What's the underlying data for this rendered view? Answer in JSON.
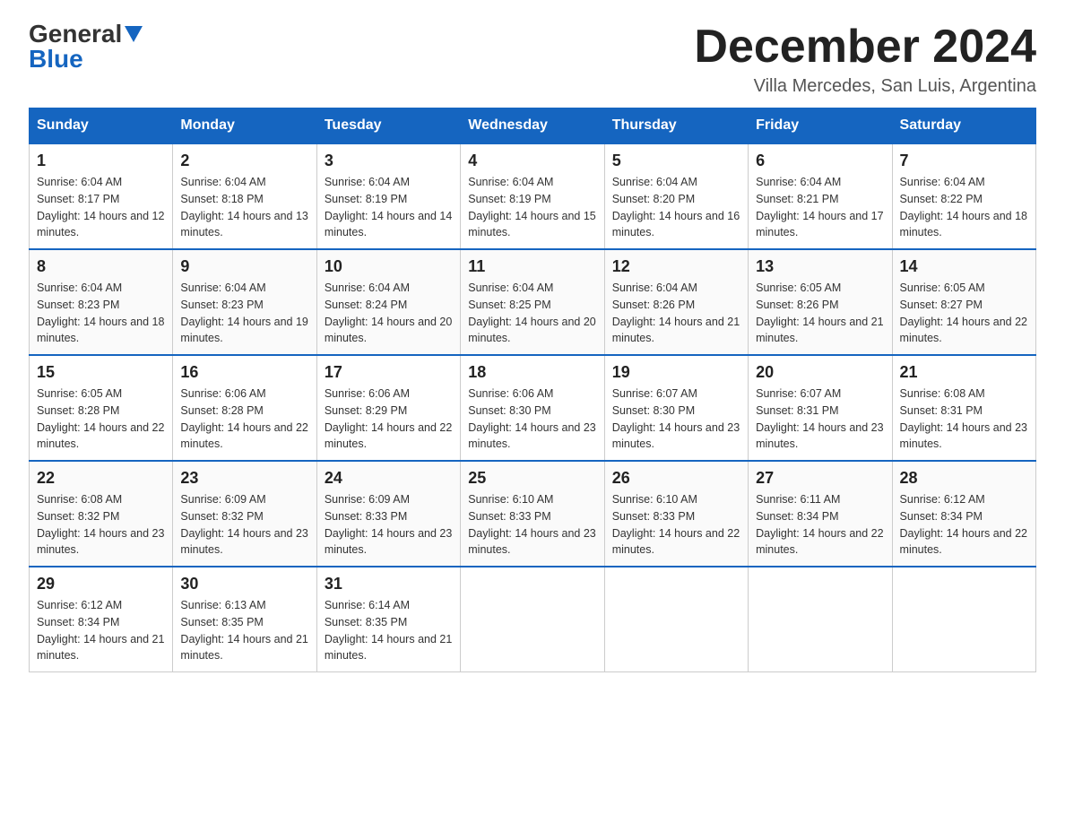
{
  "logo": {
    "general": "General",
    "blue": "Blue"
  },
  "header": {
    "month_title": "December 2024",
    "subtitle": "Villa Mercedes, San Luis, Argentina"
  },
  "days_of_week": [
    "Sunday",
    "Monday",
    "Tuesday",
    "Wednesday",
    "Thursday",
    "Friday",
    "Saturday"
  ],
  "weeks": [
    [
      {
        "day": "1",
        "sunrise": "6:04 AM",
        "sunset": "8:17 PM",
        "daylight": "14 hours and 12 minutes."
      },
      {
        "day": "2",
        "sunrise": "6:04 AM",
        "sunset": "8:18 PM",
        "daylight": "14 hours and 13 minutes."
      },
      {
        "day": "3",
        "sunrise": "6:04 AM",
        "sunset": "8:19 PM",
        "daylight": "14 hours and 14 minutes."
      },
      {
        "day": "4",
        "sunrise": "6:04 AM",
        "sunset": "8:19 PM",
        "daylight": "14 hours and 15 minutes."
      },
      {
        "day": "5",
        "sunrise": "6:04 AM",
        "sunset": "8:20 PM",
        "daylight": "14 hours and 16 minutes."
      },
      {
        "day": "6",
        "sunrise": "6:04 AM",
        "sunset": "8:21 PM",
        "daylight": "14 hours and 17 minutes."
      },
      {
        "day": "7",
        "sunrise": "6:04 AM",
        "sunset": "8:22 PM",
        "daylight": "14 hours and 18 minutes."
      }
    ],
    [
      {
        "day": "8",
        "sunrise": "6:04 AM",
        "sunset": "8:23 PM",
        "daylight": "14 hours and 18 minutes."
      },
      {
        "day": "9",
        "sunrise": "6:04 AM",
        "sunset": "8:23 PM",
        "daylight": "14 hours and 19 minutes."
      },
      {
        "day": "10",
        "sunrise": "6:04 AM",
        "sunset": "8:24 PM",
        "daylight": "14 hours and 20 minutes."
      },
      {
        "day": "11",
        "sunrise": "6:04 AM",
        "sunset": "8:25 PM",
        "daylight": "14 hours and 20 minutes."
      },
      {
        "day": "12",
        "sunrise": "6:04 AM",
        "sunset": "8:26 PM",
        "daylight": "14 hours and 21 minutes."
      },
      {
        "day": "13",
        "sunrise": "6:05 AM",
        "sunset": "8:26 PM",
        "daylight": "14 hours and 21 minutes."
      },
      {
        "day": "14",
        "sunrise": "6:05 AM",
        "sunset": "8:27 PM",
        "daylight": "14 hours and 22 minutes."
      }
    ],
    [
      {
        "day": "15",
        "sunrise": "6:05 AM",
        "sunset": "8:28 PM",
        "daylight": "14 hours and 22 minutes."
      },
      {
        "day": "16",
        "sunrise": "6:06 AM",
        "sunset": "8:28 PM",
        "daylight": "14 hours and 22 minutes."
      },
      {
        "day": "17",
        "sunrise": "6:06 AM",
        "sunset": "8:29 PM",
        "daylight": "14 hours and 22 minutes."
      },
      {
        "day": "18",
        "sunrise": "6:06 AM",
        "sunset": "8:30 PM",
        "daylight": "14 hours and 23 minutes."
      },
      {
        "day": "19",
        "sunrise": "6:07 AM",
        "sunset": "8:30 PM",
        "daylight": "14 hours and 23 minutes."
      },
      {
        "day": "20",
        "sunrise": "6:07 AM",
        "sunset": "8:31 PM",
        "daylight": "14 hours and 23 minutes."
      },
      {
        "day": "21",
        "sunrise": "6:08 AM",
        "sunset": "8:31 PM",
        "daylight": "14 hours and 23 minutes."
      }
    ],
    [
      {
        "day": "22",
        "sunrise": "6:08 AM",
        "sunset": "8:32 PM",
        "daylight": "14 hours and 23 minutes."
      },
      {
        "day": "23",
        "sunrise": "6:09 AM",
        "sunset": "8:32 PM",
        "daylight": "14 hours and 23 minutes."
      },
      {
        "day": "24",
        "sunrise": "6:09 AM",
        "sunset": "8:33 PM",
        "daylight": "14 hours and 23 minutes."
      },
      {
        "day": "25",
        "sunrise": "6:10 AM",
        "sunset": "8:33 PM",
        "daylight": "14 hours and 23 minutes."
      },
      {
        "day": "26",
        "sunrise": "6:10 AM",
        "sunset": "8:33 PM",
        "daylight": "14 hours and 22 minutes."
      },
      {
        "day": "27",
        "sunrise": "6:11 AM",
        "sunset": "8:34 PM",
        "daylight": "14 hours and 22 minutes."
      },
      {
        "day": "28",
        "sunrise": "6:12 AM",
        "sunset": "8:34 PM",
        "daylight": "14 hours and 22 minutes."
      }
    ],
    [
      {
        "day": "29",
        "sunrise": "6:12 AM",
        "sunset": "8:34 PM",
        "daylight": "14 hours and 21 minutes."
      },
      {
        "day": "30",
        "sunrise": "6:13 AM",
        "sunset": "8:35 PM",
        "daylight": "14 hours and 21 minutes."
      },
      {
        "day": "31",
        "sunrise": "6:14 AM",
        "sunset": "8:35 PM",
        "daylight": "14 hours and 21 minutes."
      },
      null,
      null,
      null,
      null
    ]
  ],
  "labels": {
    "sunrise_prefix": "Sunrise: ",
    "sunset_prefix": "Sunset: ",
    "daylight_prefix": "Daylight: "
  }
}
